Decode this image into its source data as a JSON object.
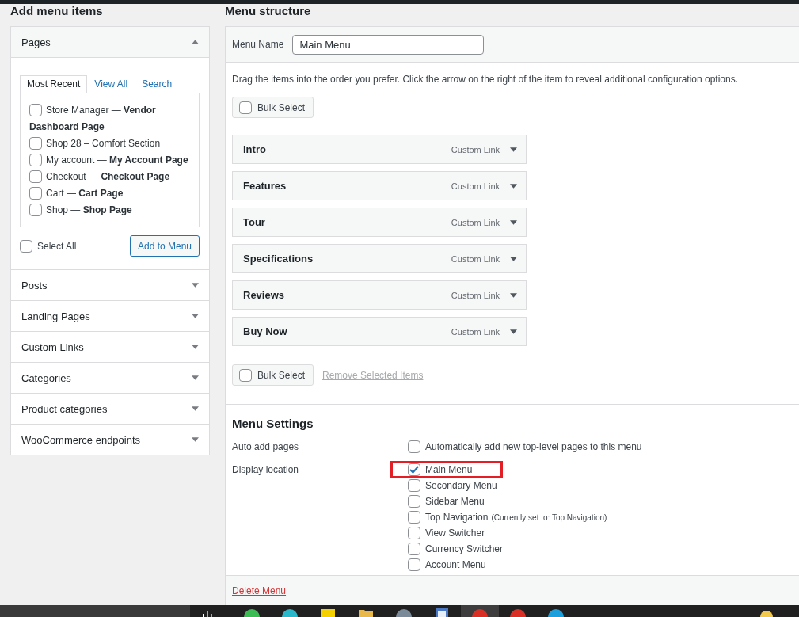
{
  "left_column": {
    "title": "Add menu items",
    "sections": [
      {
        "title": "Pages",
        "expanded": true,
        "tabs": [
          {
            "label": "Most Recent",
            "selected": true
          },
          {
            "label": "View All",
            "selected": false
          },
          {
            "label": "Search",
            "selected": false
          }
        ],
        "items": [
          {
            "label": "Store Manager — **Vendor Dashboard Page**",
            "checked": false
          },
          {
            "label": "Shop 28 – Comfort Section",
            "checked": false
          },
          {
            "label": "My account — **My Account Page**",
            "checked": false
          },
          {
            "label": "Checkout — **Checkout Page**",
            "checked": false
          },
          {
            "label": "Cart — **Cart Page**",
            "checked": false
          },
          {
            "label": "Shop — **Shop Page**",
            "checked": false
          }
        ],
        "select_all": {
          "label": "Select All",
          "checked": false
        },
        "add_button": "Add to Menu"
      },
      {
        "title": "Posts",
        "expanded": false
      },
      {
        "title": "Landing Pages",
        "expanded": false
      },
      {
        "title": "Custom Links",
        "expanded": false
      },
      {
        "title": "Categories",
        "expanded": false
      },
      {
        "title": "Product categories",
        "expanded": false
      },
      {
        "title": "WooCommerce endpoints",
        "expanded": false
      }
    ]
  },
  "menu_structure": {
    "title": "Menu structure",
    "menu_name": {
      "label": "Menu Name",
      "value": "Main Menu"
    },
    "instructions": "Drag the items into the order you prefer. Click the arrow on the right of the item to reveal additional configuration options.",
    "bulk_select_top": {
      "label": "Bulk Select",
      "checked": false
    },
    "items": [
      {
        "title": "Intro",
        "type": "Custom Link"
      },
      {
        "title": "Features",
        "type": "Custom Link"
      },
      {
        "title": "Tour",
        "type": "Custom Link"
      },
      {
        "title": "Specifications",
        "type": "Custom Link"
      },
      {
        "title": "Reviews",
        "type": "Custom Link"
      },
      {
        "title": "Buy Now",
        "type": "Custom Link"
      }
    ],
    "bulk_select_bottom": {
      "label": "Bulk Select",
      "checked": false
    },
    "remove_link": {
      "label": "Remove Selected Items",
      "disabled": true
    },
    "settings": {
      "title": "Menu Settings",
      "rows": [
        {
          "label": "Auto add pages",
          "options": [
            {
              "label": "Automatically add new top-level pages to this menu",
              "checked": false,
              "highlighted": false
            }
          ]
        },
        {
          "label": "Display location",
          "options": [
            {
              "label": "Main Menu",
              "checked": true,
              "highlighted": true
            },
            {
              "label": "Secondary Menu",
              "checked": false,
              "highlighted": false
            },
            {
              "label": "Sidebar Menu",
              "checked": false,
              "highlighted": false
            },
            {
              "label": "Top Navigation",
              "note": "(Currently set to: Top Navigation)",
              "checked": false,
              "highlighted": false
            },
            {
              "label": "View Switcher",
              "checked": false,
              "highlighted": false
            },
            {
              "label": "Currency Switcher",
              "checked": false,
              "highlighted": false
            },
            {
              "label": "Account Menu",
              "checked": false,
              "highlighted": false
            }
          ]
        }
      ]
    },
    "delete_link": "Delete Menu"
  },
  "taskbar": {
    "apps": [
      {
        "kind": "round",
        "color": "#3cba54",
        "selected": false
      },
      {
        "kind": "round",
        "color": "#2ab7c9",
        "selected": false
      },
      {
        "kind": "square",
        "color": "#f5d000",
        "selected": false
      },
      {
        "kind": "folder",
        "color": "#e8b84a",
        "selected": false
      },
      {
        "kind": "round",
        "color": "#7a8a99",
        "selected": false
      },
      {
        "kind": "document",
        "color": "#4a78c2",
        "selected": false
      },
      {
        "kind": "round",
        "color": "#d93025",
        "selected": true
      },
      {
        "kind": "round",
        "color": "#d93025",
        "selected": false
      },
      {
        "kind": "round",
        "color": "#1a9fdc",
        "selected": false
      }
    ]
  }
}
